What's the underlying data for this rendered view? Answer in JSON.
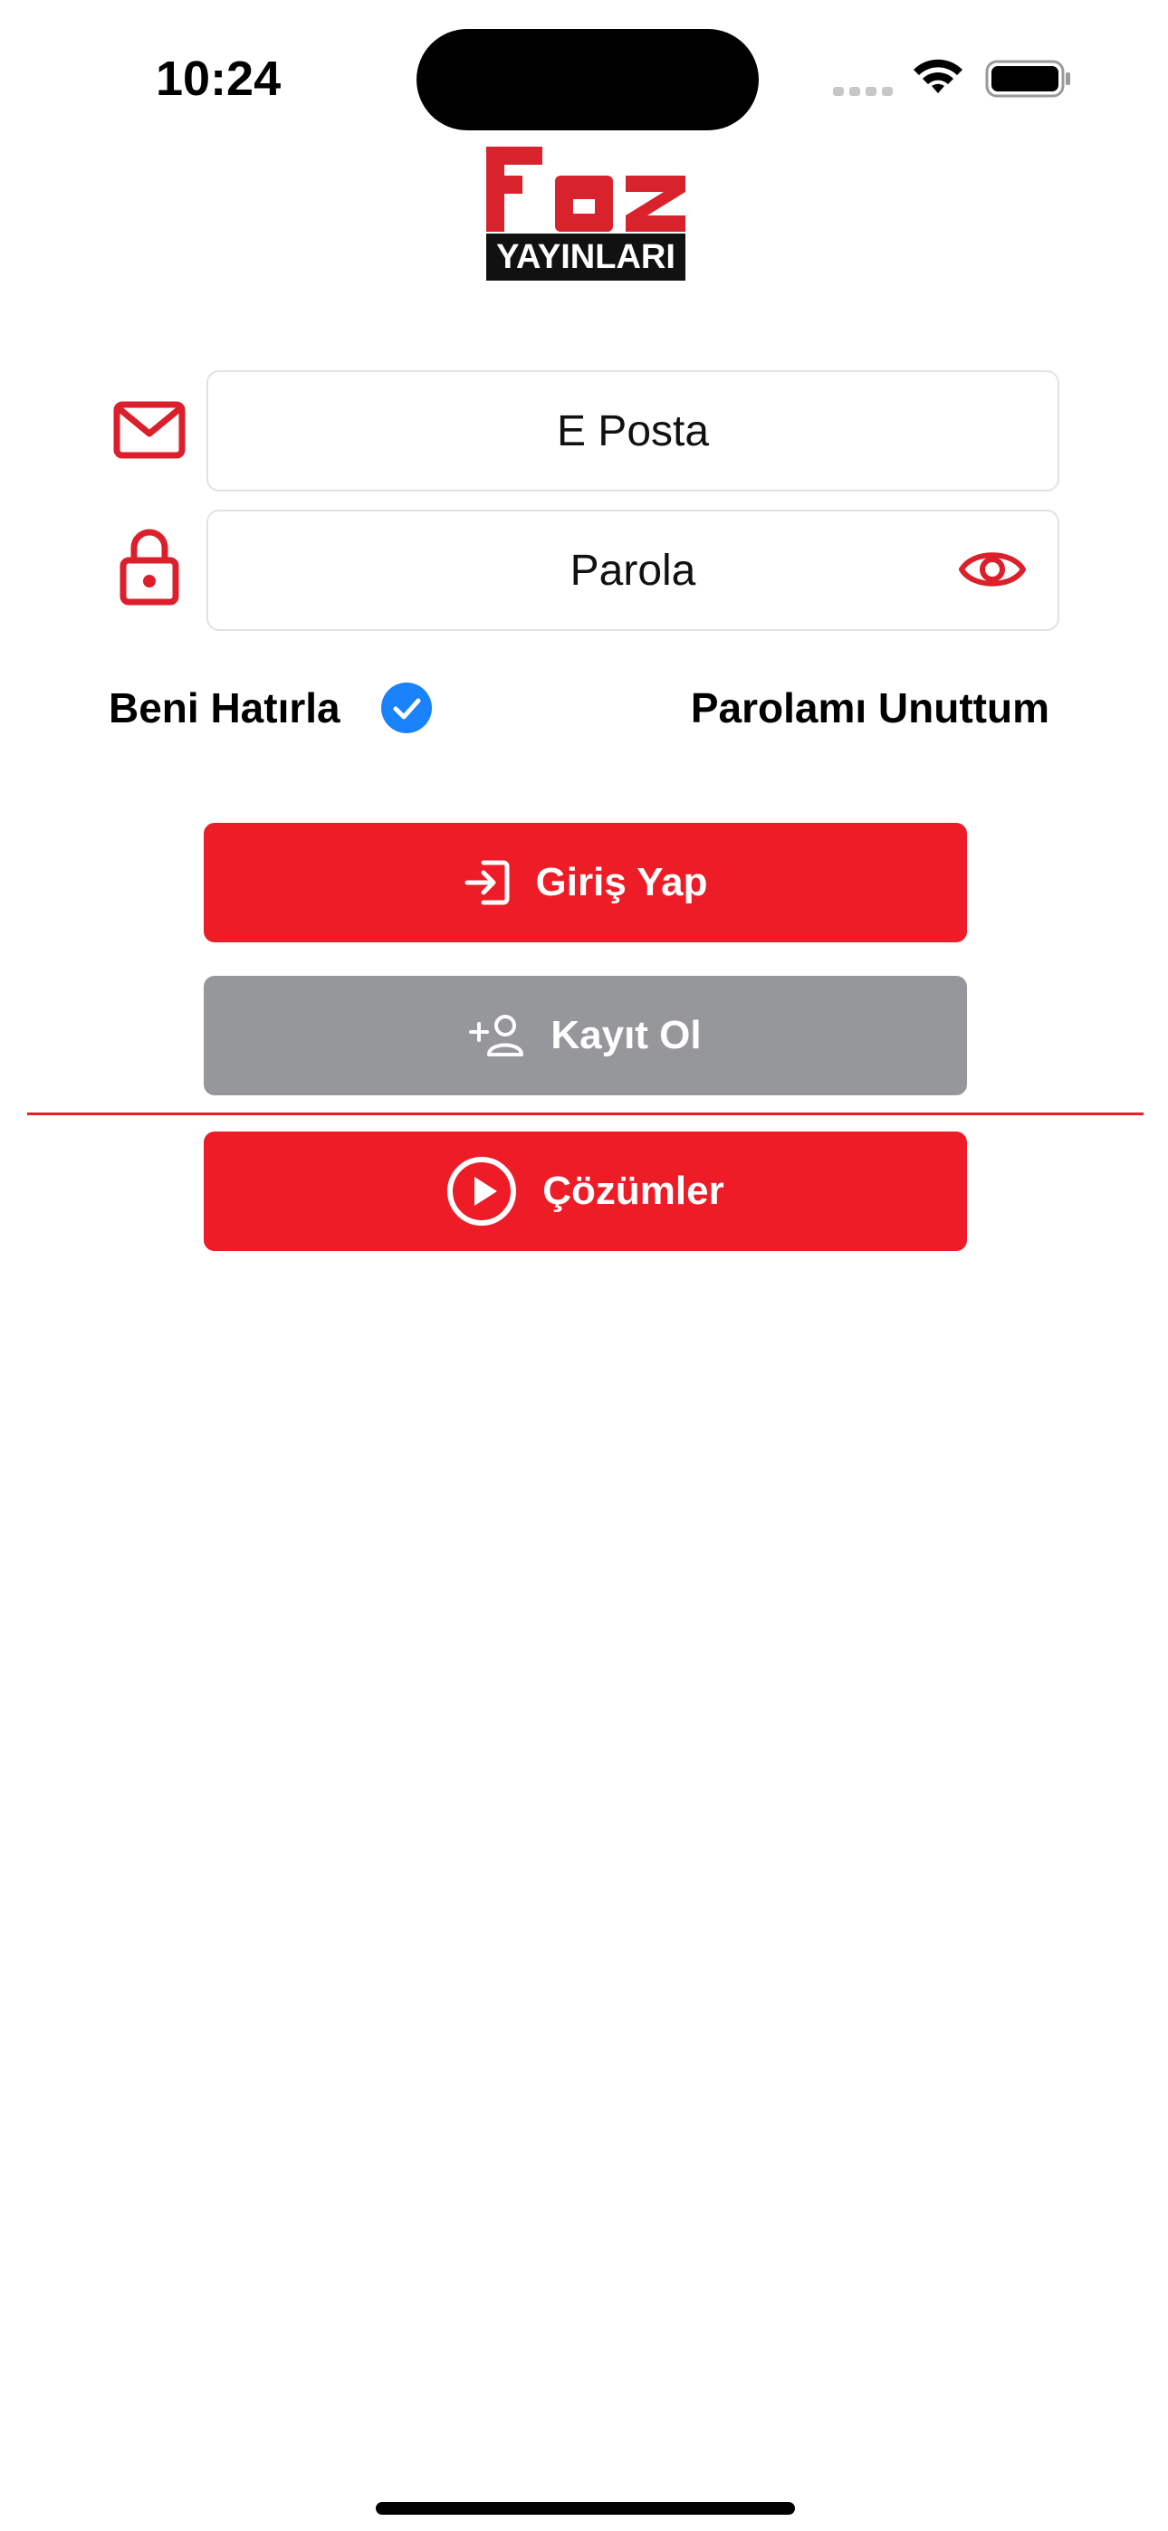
{
  "status_bar": {
    "time": "10:24"
  },
  "logo": {
    "brand": "Faz",
    "subtitle": "YAYINLARI"
  },
  "form": {
    "email_placeholder": "E Posta",
    "password_placeholder": "Parola",
    "remember_label": "Beni Hatırla",
    "remember_checked": true,
    "forgot_label": "Parolamı Unuttum"
  },
  "buttons": {
    "login_label": "Giriş Yap",
    "register_label": "Kayıt Ol",
    "solutions_label": "Çözümler"
  },
  "colors": {
    "brand_red": "#ed1c26",
    "register_gray": "#96979b",
    "check_blue": "#1a82fb"
  },
  "icons": {
    "email": "mail-icon",
    "password": "lock-icon",
    "show_password": "eye-icon",
    "remember": "checkmark-circle-icon",
    "login": "login-arrow-icon",
    "register": "add-user-icon",
    "solutions": "play-circle-icon"
  }
}
